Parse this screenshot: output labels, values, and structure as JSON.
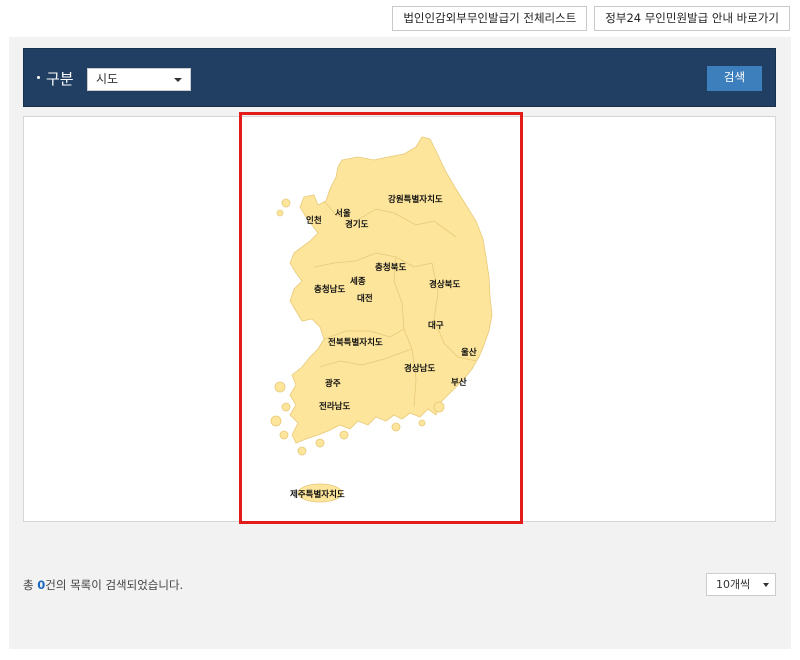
{
  "top_links": {
    "corp_seal": "법인인감외부무인발급기 전체리스트",
    "gov24": "정부24 무인민원발급 안내 바로가기"
  },
  "search": {
    "label": "구분",
    "select_value": "시도",
    "button": "검색"
  },
  "map": {
    "regions": {
      "incheon": "인천",
      "seoul": "서울",
      "gyeonggi": "경기도",
      "gangwon": "강원특별자치도",
      "chungbuk": "충청북도",
      "chungnam": "충청남도",
      "sejong": "세종",
      "daejeon": "대전",
      "gyeongbuk": "경상북도",
      "daegu": "대구",
      "jeonbuk": "전북특별자치도",
      "ulsan": "울산",
      "gyeongnam": "경상남도",
      "busan": "부산",
      "gwangju": "광주",
      "jeonnam": "전라남도",
      "jeju": "제주특별자치도"
    },
    "fill_color": "#fde59c",
    "highlight_color": "#e21b1b"
  },
  "result": {
    "prefix": "총 ",
    "count": "0",
    "suffix": "건의 목록이 검색되었습니다."
  },
  "pagination": {
    "per_page": "10개씩"
  }
}
